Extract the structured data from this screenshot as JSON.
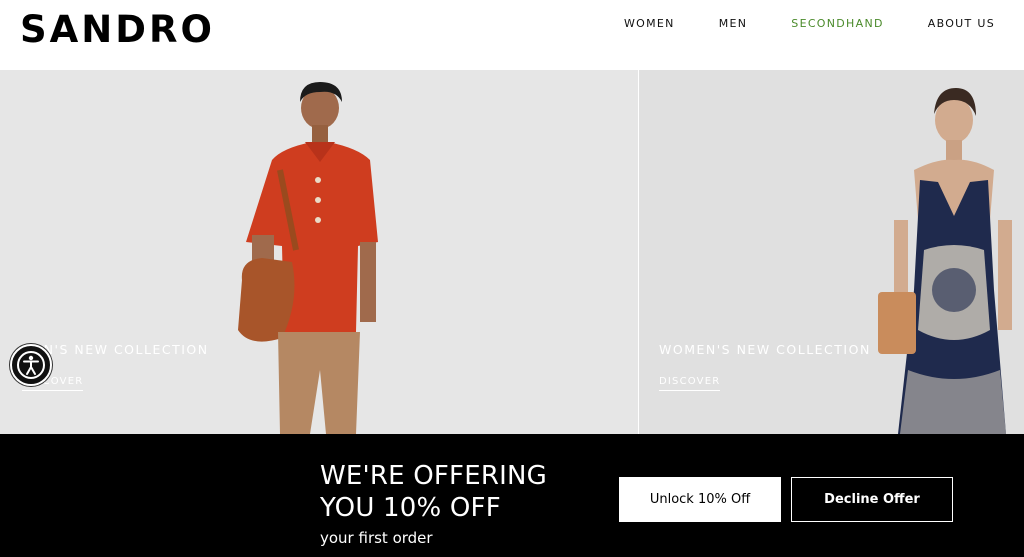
{
  "brand": {
    "logo": "SANDRO"
  },
  "nav": {
    "items": [
      {
        "label": "WOMEN"
      },
      {
        "label": "MEN"
      },
      {
        "label": "SECONDHAND"
      },
      {
        "label": "ABOUT US"
      }
    ],
    "secondhand_color": "#4a8a2a"
  },
  "hero": {
    "left": {
      "title": "MEN'S NEW COLLECTION",
      "link": "DISCOVER"
    },
    "right": {
      "title": "WOMEN'S NEW COLLECTION",
      "link": "DISCOVER"
    }
  },
  "offer": {
    "headline_line1": "WE'RE OFFERING",
    "headline_line2": "YOU 10% OFF",
    "subline": "your first order",
    "unlock_label": "Unlock 10% Off",
    "decline_label": "Decline Offer"
  },
  "accessibility": {
    "icon": "accessibility-icon"
  }
}
